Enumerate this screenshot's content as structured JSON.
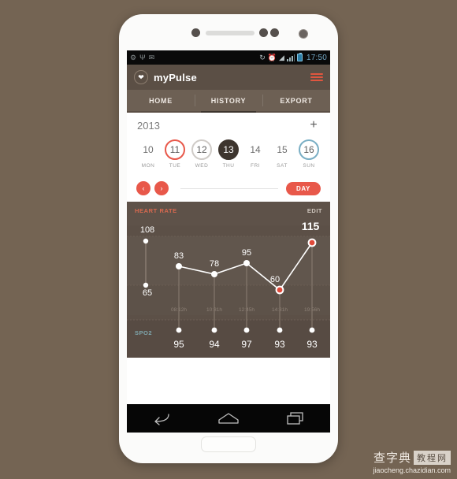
{
  "status_bar": {
    "left_icons": [
      "usb-debug-icon",
      "usb-icon",
      "gmail-icon"
    ],
    "right_icons": [
      "sync-icon",
      "alarm-icon",
      "wifi-icon",
      "signal-icon",
      "battery-icon"
    ],
    "clock": "17:50"
  },
  "app_bar": {
    "logo_icon": "heart-icon",
    "title": "myPulse",
    "menu_icon": "hamburger-menu-icon",
    "accent_color": "#e0563f",
    "background_color": "#5b4f45"
  },
  "tabs": [
    {
      "label": "HOME",
      "active": false
    },
    {
      "label": "HISTORY",
      "active": true
    },
    {
      "label": "EXPORT",
      "active": false
    }
  ],
  "year_row": {
    "year": "2013",
    "add_label": "+"
  },
  "days": [
    {
      "num": "10",
      "name": "MON",
      "style": "plain"
    },
    {
      "num": "11",
      "name": "TUE",
      "style": "ring-red"
    },
    {
      "num": "12",
      "name": "WED",
      "style": "ring-gray"
    },
    {
      "num": "13",
      "name": "THU",
      "style": "filled"
    },
    {
      "num": "14",
      "name": "FRI",
      "style": "plain"
    },
    {
      "num": "15",
      "name": "SAT",
      "style": "plain"
    },
    {
      "num": "16",
      "name": "SUN",
      "style": "ring-blue"
    }
  ],
  "controls": {
    "prev_icon": "chevron-left-icon",
    "prev_label": "‹",
    "next_icon": "chevron-right-icon",
    "next_label": "›",
    "range_label": "DAY",
    "accent_color": "#e8584a"
  },
  "chart_card": {
    "title": "HEART RATE",
    "edit_label": "EDIT",
    "title_color": "#d9694f",
    "background_color": "#5c5047",
    "spo2_label": "SPO2",
    "spo2_color": "#7fa6ad"
  },
  "chart_data": {
    "type": "line",
    "title": "HEART RATE",
    "xlabel": "",
    "ylabel": "",
    "ylim": [
      55,
      120
    ],
    "grid": true,
    "legend": "none",
    "x": [
      "08:12h",
      "10:31h",
      "12:45h",
      "14:31h",
      "19:56h"
    ],
    "series": [
      {
        "name": "Heart rate",
        "values": [
          83,
          78,
          95,
          60,
          115
        ],
        "highlight": [
          false,
          false,
          false,
          true,
          true
        ]
      },
      {
        "name": "SPO2",
        "values": [
          95,
          94,
          97,
          93,
          93
        ]
      }
    ],
    "range_marker": {
      "max": 108,
      "min": 65,
      "label_max": "108",
      "label_min": "65"
    },
    "point_labels": [
      "83",
      "78",
      "95",
      "60",
      "115"
    ],
    "tick_labels": [
      "08:12h",
      "10:31h",
      "12:45h",
      "14:31h",
      "19:56h"
    ],
    "spo2_labels": [
      "95",
      "94",
      "97",
      "93",
      "93"
    ],
    "highlight_color": "#e04a3a",
    "line_color": "#ffffff"
  },
  "nav_bar": {
    "back_icon": "back-arrow-icon",
    "home_icon": "home-icon",
    "recents_icon": "recent-apps-icon"
  },
  "watermark": {
    "cn_text": "查字典",
    "cn_box": "教程网",
    "url": "jiaocheng.chazidian.com"
  }
}
